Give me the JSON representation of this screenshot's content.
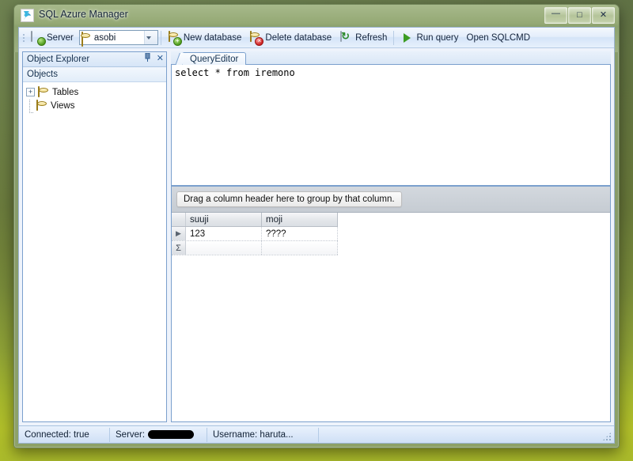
{
  "window": {
    "title": "SQL Azure Manager",
    "app_icon": "sql-azure-icon",
    "caption": {
      "minimize": "—",
      "maximize": "□",
      "close": "✕"
    }
  },
  "toolbar": {
    "server_button": "Server",
    "database_combo": {
      "value": "asobi",
      "icon": "database-icon"
    },
    "new_database": "New database",
    "delete_database": "Delete database",
    "refresh": "Refresh",
    "run_query": "Run query",
    "open_sqlcmd": "Open SQLCMD"
  },
  "object_explorer": {
    "title": "Object Explorer",
    "pin_glyph": "↧",
    "close_glyph": "✕",
    "subheader": "Objects",
    "tree": [
      {
        "label": "Tables",
        "expander": "+",
        "icon": "database-icon"
      },
      {
        "label": "Views",
        "expander": "",
        "icon": "database-icon"
      }
    ]
  },
  "editor": {
    "tab_label": "QueryEditor",
    "text": "select * from iremono"
  },
  "results": {
    "group_hint": "Drag a column header here to group by that column.",
    "columns": [
      "suuji",
      "moji"
    ],
    "rows": [
      {
        "indicator": "▶",
        "cells": [
          "123",
          "????"
        ]
      }
    ],
    "summary_row": {
      "indicator": "Σ",
      "cells": [
        "",
        ""
      ]
    }
  },
  "statusbar": {
    "connected": "Connected: true",
    "server_label": "Server:",
    "server_value_redacted": "",
    "username": "Username: haruta...",
    "grip": "resize-grip"
  },
  "colors": {
    "accent": "#7ba0cd",
    "toolbar_top": "#f4f8fd",
    "status_bg": "#dfeafa",
    "desktop_green": "#77893f",
    "desktop_lime": "#d9e82a"
  }
}
